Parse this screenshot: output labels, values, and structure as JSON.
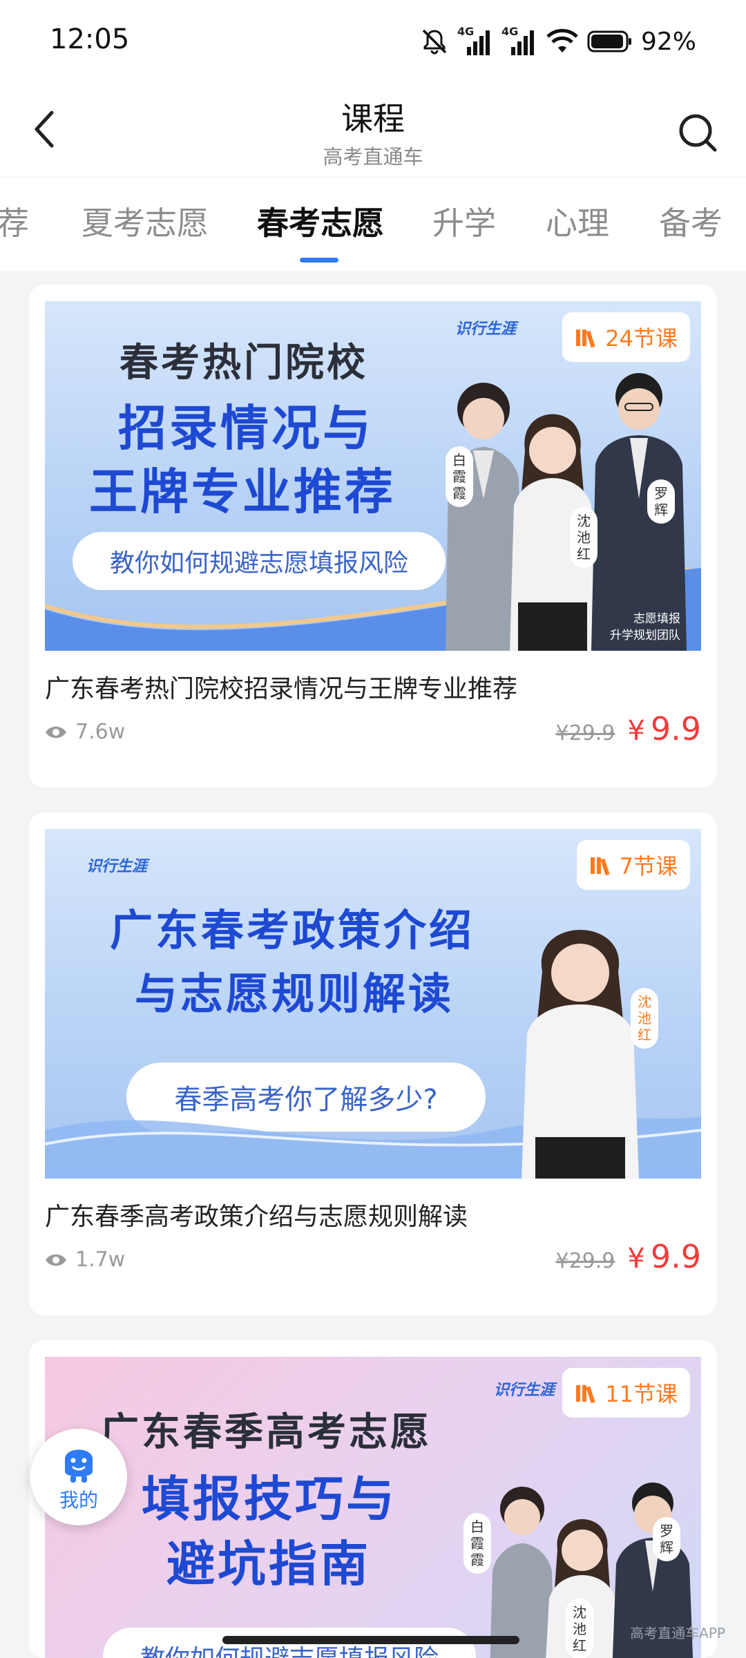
{
  "status_bar": {
    "time": "12:05",
    "battery_percent": "92%",
    "network_1": "4G",
    "network_2": "4G"
  },
  "header": {
    "title": "课程",
    "subtitle": "高考直通车"
  },
  "tabs": [
    {
      "label": "荐",
      "active": false
    },
    {
      "label": "夏考志愿",
      "active": false
    },
    {
      "label": "春考志愿",
      "active": true
    },
    {
      "label": "升学",
      "active": false
    },
    {
      "label": "心理",
      "active": false
    },
    {
      "label": "备考",
      "active": false
    }
  ],
  "courses": [
    {
      "banner": {
        "brand": "识行生涯",
        "lessons": "24节课",
        "line1": "春考热门院校",
        "line2": "招录情况与",
        "line3": "王牌专业推荐",
        "pill": "教你如何规避志愿填报风险",
        "teachers": [
          "白霞霞",
          "沈池红",
          "罗辉"
        ],
        "team_line1": "志愿填报",
        "team_line2": "升学规划团队"
      },
      "title": "广东春考热门院校招录情况与王牌专业推荐",
      "views": "7.6w",
      "original_price": "¥29.9",
      "price": "9.9"
    },
    {
      "banner": {
        "brand": "识行生涯",
        "lessons": "7节课",
        "line1": "广东春考政策介绍",
        "line2": "与志愿规则解读",
        "pill": "春季高考你了解多少?",
        "teachers": [
          "沈池红"
        ]
      },
      "title": "广东春季高考政策介绍与志愿规则解读",
      "views": "1.7w",
      "original_price": "¥29.9",
      "price": "9.9"
    },
    {
      "banner": {
        "brand": "识行生涯",
        "lessons": "11节课",
        "line1": "广东春季高考志愿",
        "line2": "填报技巧与",
        "line3": "避坑指南",
        "pill": "教你如何规避志愿填报风险",
        "teachers": [
          "白霞霞",
          "沈池红",
          "罗辉"
        ]
      }
    }
  ],
  "fab": {
    "label": "我的"
  },
  "watermark": "高考直通车APP",
  "currency_symbol": "¥",
  "colors": {
    "accent": "#2f7bf5",
    "price": "#f03c3c",
    "badge": "#ff7a1f"
  }
}
